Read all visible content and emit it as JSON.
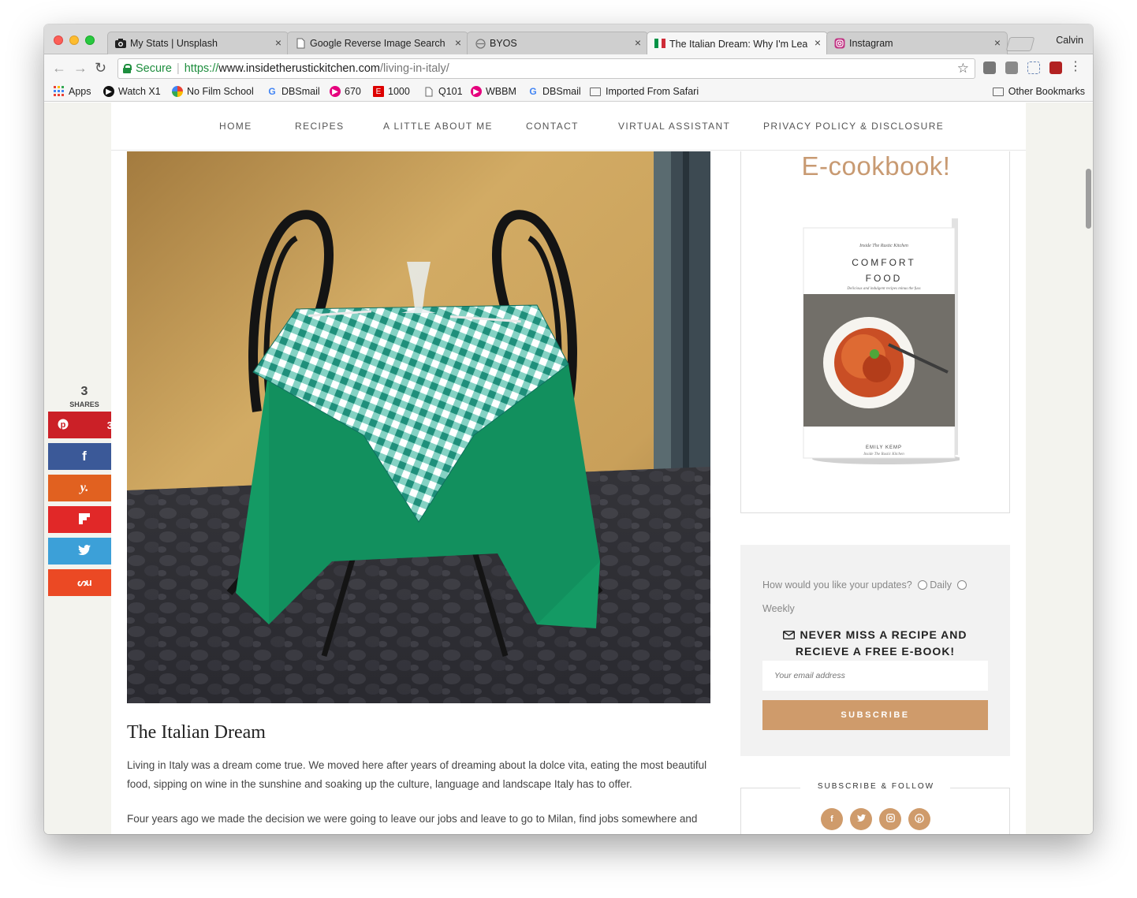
{
  "browser": {
    "tabs": [
      {
        "title": "My Stats | Unsplash",
        "icon": "camera-icon"
      },
      {
        "title": "Google Reverse Image Search",
        "icon": "page-icon"
      },
      {
        "title": "BYOS",
        "icon": "globe-icon"
      },
      {
        "title": "The Italian Dream: Why I'm Lea",
        "icon": "italy-flag-icon"
      },
      {
        "title": "Instagram",
        "icon": "instagram-icon"
      }
    ],
    "active_tab": 3,
    "profile": "Calvin",
    "secure_label": "Secure",
    "url_scheme": "https://",
    "url_host": "www.insidetherustickitchen.com",
    "url_path": "/living-in-italy/",
    "bookmarks": [
      {
        "label": "Apps",
        "icon": "apps-grid-icon"
      },
      {
        "label": "Watch X1",
        "icon": "play-icon"
      },
      {
        "label": "No Film School",
        "icon": "nfs-icon"
      },
      {
        "label": "DBSmail",
        "icon": "google-icon"
      },
      {
        "label": "670",
        "icon": "radio-icon"
      },
      {
        "label": "1000",
        "icon": "espn-icon"
      },
      {
        "label": "Q101",
        "icon": "page-icon"
      },
      {
        "label": "WBBM",
        "icon": "radio-icon"
      },
      {
        "label": "DBSmail",
        "icon": "google-icon"
      },
      {
        "label": "Imported From Safari",
        "icon": "folder-icon"
      }
    ],
    "other_bookmarks": "Other Bookmarks"
  },
  "site": {
    "nav": [
      "HOME",
      "RECIPES",
      "A LITTLE ABOUT ME",
      "CONTACT",
      "VIRTUAL ASSISTANT",
      "PRIVACY POLICY & DISCLOSURE"
    ],
    "post_title": "The Italian Dream",
    "paragraphs": [
      "Living in Italy was a dream come true. We moved here after years of dreaming about la dolce vita, eating the most beautiful food, sipping on wine in the sunshine and soaking up the culture, language and landscape Italy has to offer.",
      "Four years ago we made the decision we were going to leave our jobs and leave to go to Milan, find jobs somewhere and try as"
    ],
    "share": {
      "count": "3",
      "label": "SHARES",
      "pinterest_count": "3",
      "buttons": [
        {
          "name": "pinterest",
          "glyph": "P",
          "color": "#cb2027"
        },
        {
          "name": "facebook",
          "glyph": "f",
          "color": "#3b5998"
        },
        {
          "name": "yummly",
          "glyph": "Y",
          "color": "#e16120"
        },
        {
          "name": "flipboard",
          "glyph": "F",
          "color": "#e12828"
        },
        {
          "name": "twitter",
          "glyph": "t",
          "color": "#3ca0d8"
        },
        {
          "name": "stumbleupon",
          "glyph": "Su",
          "color": "#eb4924"
        }
      ]
    },
    "sidebar": {
      "ebook_title": "E-cookbook!",
      "book": {
        "kicker": "Inside The Rustic Kitchen",
        "title_line1": "COMFORT",
        "title_line2": "FOOD",
        "subtitle": "Delicious and indulgent recipes minus the fuss",
        "author": "EMILY KEMP",
        "author_sub": "Inside The Rustic Kitchen"
      },
      "newsletter": {
        "question": "How would you like your updates?",
        "option_daily": "Daily",
        "option_weekly": "Weekly",
        "heading_line1": "NEVER MISS A RECIPE AND",
        "heading_line2": "RECIEVE A FREE E-BOOK!",
        "email_placeholder": "Your email address",
        "button": "SUBSCRIBE"
      },
      "follow_title": "SUBSCRIBE & FOLLOW",
      "social": [
        {
          "name": "facebook",
          "glyph": "f"
        },
        {
          "name": "twitter",
          "glyph": "t"
        },
        {
          "name": "instagram",
          "glyph": "ig"
        },
        {
          "name": "pinterest",
          "glyph": "p"
        }
      ]
    }
  }
}
